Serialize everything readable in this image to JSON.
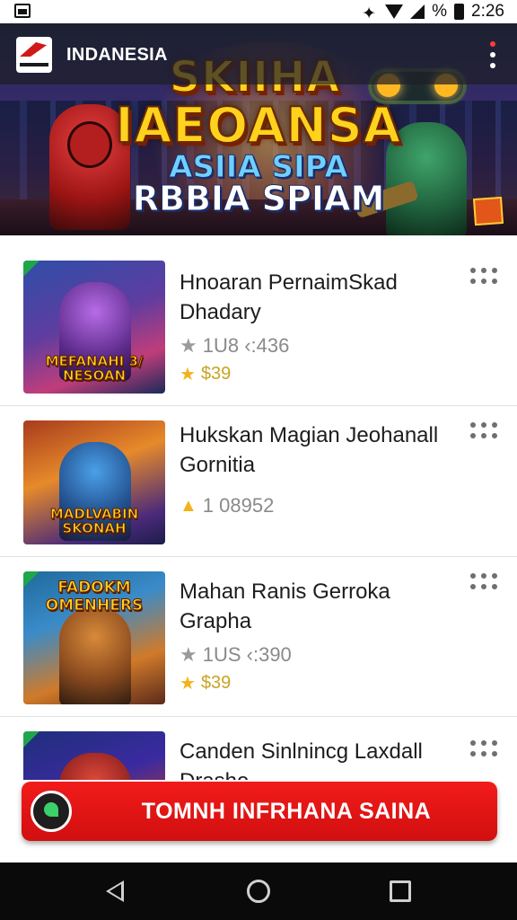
{
  "status_bar": {
    "time": "2:26",
    "battery_percent_text": "%"
  },
  "app_bar": {
    "title": "INDANESIA",
    "logo_icon": "brand-logo-icon",
    "menu_icon": "more-vert-icon"
  },
  "hero": {
    "title_line_1": "SKIIHA",
    "title_line_2": "IAEOANSA",
    "subtitle_line_1": "ASIIA SIPA",
    "subtitle_line_2": "RBBIA SPIAM"
  },
  "items": [
    {
      "title": "Hnoaran PernaimSkad Dhadary",
      "rating_text": "1U8 ‹:436",
      "price": "$39",
      "thumb_text": "MEFANAHI 3/ NESOAN"
    },
    {
      "title": "Hukskan Magian Jeohanall Gornitia",
      "rating_text": "1 08952",
      "price": "",
      "thumb_text": "MADLVABIN SKONAH"
    },
    {
      "title": "Mahan Ranis Gerroka Grapha",
      "rating_text": "1US ‹:390",
      "price": "$39",
      "thumb_text": "FADOKM OMENHERS"
    },
    {
      "title": "Canden Sinlnincg Laxdall Drashe",
      "rating_text": "",
      "price": "",
      "thumb_text": ""
    }
  ],
  "cta": {
    "label": "TOMNH INFRHANA SAINA"
  },
  "colors": {
    "accent_red": "#e8141a",
    "price_gold": "#c9a422",
    "star_gold": "#f2b21b"
  }
}
